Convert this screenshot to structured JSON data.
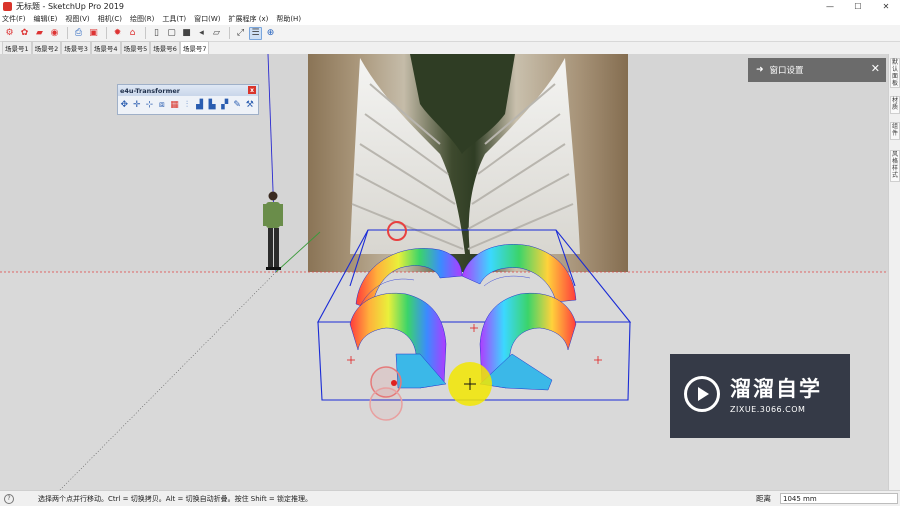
{
  "window": {
    "title": "无标题 - SketchUp Pro 2019",
    "controls": [
      "—",
      "☐",
      "✕"
    ]
  },
  "menu": [
    "文件(F)",
    "编辑(E)",
    "视图(V)",
    "相机(C)",
    "绘图(R)",
    "工具(T)",
    "窗口(W)",
    "扩展程序 (x)",
    "帮助(H)"
  ],
  "scenes": [
    "场景号1",
    "场景号2",
    "场景号3",
    "场景号4",
    "场景号5",
    "场景号6",
    "场景号7"
  ],
  "active_scene_index": 6,
  "panel": {
    "title": "窗口设置",
    "close_icon": "close-icon"
  },
  "transformer": {
    "title": "e4u-Transformer",
    "icons": [
      "move-icon",
      "move-axis-icon",
      "move-points-icon",
      "scale-icon",
      "color-icon",
      "align-icon",
      "bars-icon",
      "distribute-icon",
      "stack-icon",
      "edit-icon",
      "tool-icon"
    ]
  },
  "right_tray": [
    "默认面板",
    "材质",
    "组件",
    "风格样式"
  ],
  "watermark": {
    "brand": "溜溜自学",
    "url": "ZIXUE.3066.COM"
  },
  "status": {
    "hint": "选择两个点并行移动。Ctrl = 切换拷贝。Alt = 切换自动折叠。按住 Shift = 锁定推理。",
    "measure_label": "距离",
    "measure_value": "1045 mm"
  },
  "colors": {
    "bounding_box": "#1a2bd6",
    "red_axis": "#e04040",
    "green_axis": "#3a9a3a",
    "blue_axis": "#2a2ad0",
    "cursor_highlight": "#f2e600"
  }
}
